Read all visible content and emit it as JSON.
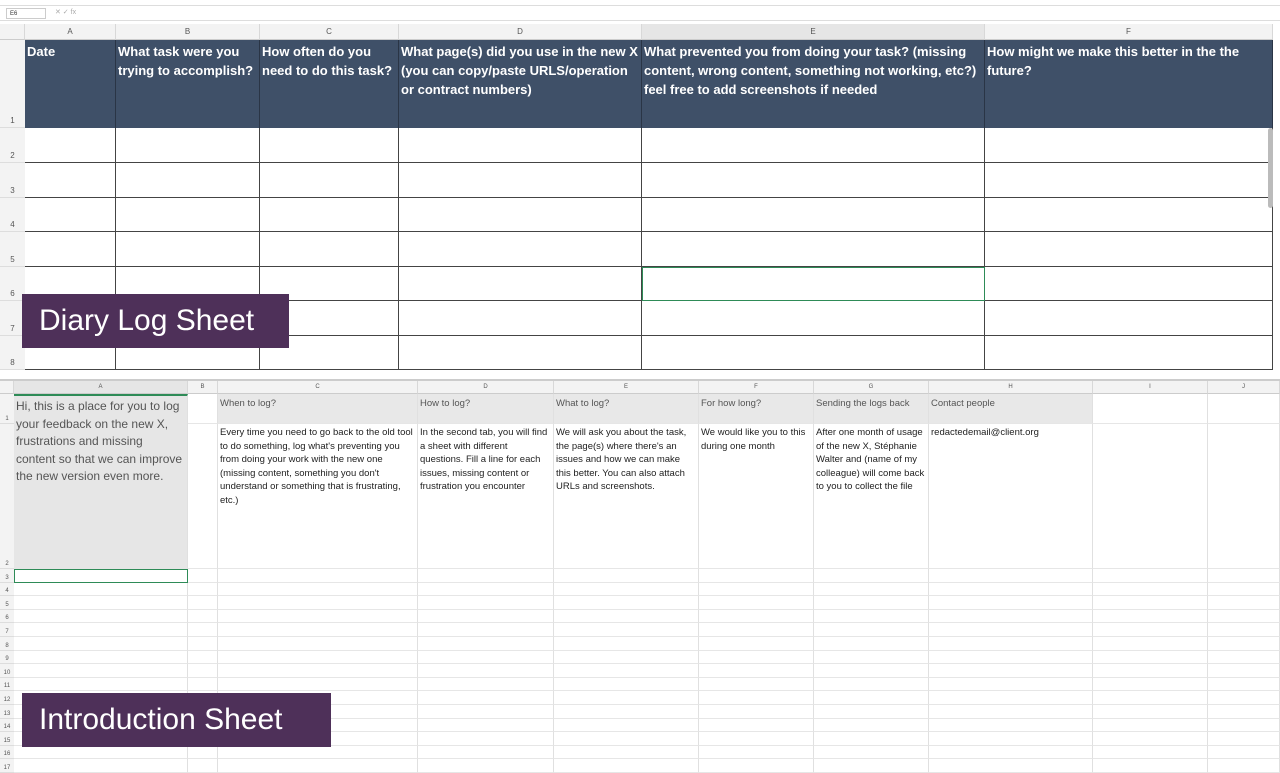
{
  "formula_bar": {
    "name_box": "E6",
    "fx_label": "fx"
  },
  "diary": {
    "label": "Diary Log Sheet",
    "columns": [
      "A",
      "B",
      "C",
      "D",
      "E",
      "F"
    ],
    "rows": [
      "1",
      "2",
      "3",
      "4",
      "5",
      "6",
      "7",
      "8"
    ],
    "headers": [
      "Date",
      "What task were you trying to accomplish?",
      "How often do you need to do this task?",
      "What page(s) did you use in the new X (you can copy/paste URLS/operation or contract numbers)",
      "What prevented you from doing your task? (missing content, wrong content, something not working, etc?) feel free to add screenshots if needed",
      "How might we make this better in the the future?"
    ],
    "selected_cell": "E6",
    "header_color": "#3f5068"
  },
  "intro": {
    "label": "Introduction Sheet",
    "columns": [
      "A",
      "B",
      "C",
      "D",
      "E",
      "F",
      "G",
      "H",
      "I",
      "J"
    ],
    "rows": [
      "1",
      "2",
      "3",
      "4",
      "5",
      "6",
      "7",
      "8",
      "9",
      "10",
      "11",
      "12",
      "13",
      "14",
      "15",
      "16",
      "17"
    ],
    "intro_text": "Hi, this is a place for you to log your feedback on the new X, frustrations and missing content so that we can improve the new version even more.",
    "headers": [
      "When to log?",
      "How to log?",
      "What to log?",
      "For how long?",
      "Sending the logs back",
      "Contact people"
    ],
    "bodies": [
      "Every time you need to go back to the old tool to do something, log what's preventing you from doing your work with the new one (missing content, something you don't understand or something that is frustrating, etc.)",
      "In the second tab, you will find a sheet with different questions. Fill a line for each issues, missing content or frustration you encounter",
      "We will ask you about the task, the page(s) where there's an issues and how we can make this better. You can also attach URLs and screenshots.",
      "We would like you to this during one month",
      "After one month of usage of the new X, Stéphanie Walter and (name of my colleague) will come back to you to collect the file",
      "redactedemail@client.org"
    ],
    "selected_cell": "A3",
    "label_color": "#4e3059"
  }
}
